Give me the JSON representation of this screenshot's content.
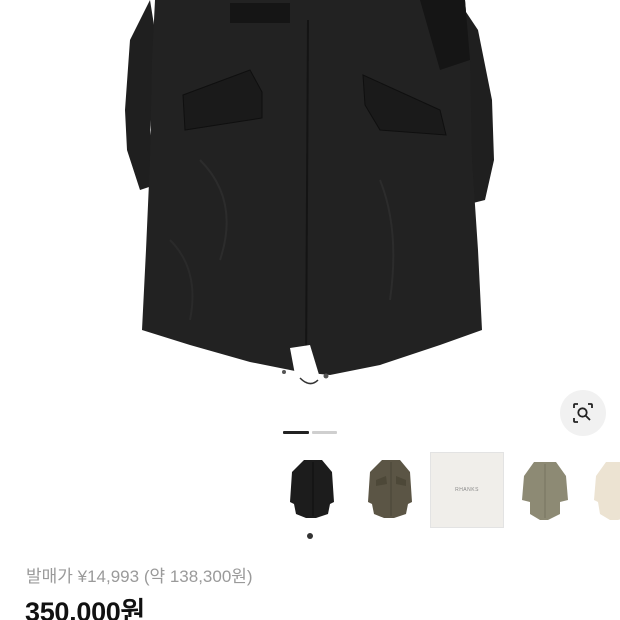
{
  "product": {
    "original_price_label": "발매가 ¥14,993 (약 138,300원)",
    "sale_price": "350,000원"
  },
  "gallery": {
    "current_slide": 1,
    "total_slides": 2
  },
  "thumbnails": {
    "items": [
      {
        "name": "black-coat",
        "selected": true
      },
      {
        "name": "olive-coat",
        "selected": false
      },
      {
        "name": "brand-box",
        "label": "RHANKS"
      },
      {
        "name": "khaki-coat",
        "selected": false
      },
      {
        "name": "cream-coat",
        "selected": false
      }
    ]
  },
  "icons": {
    "lens": "image-search-icon"
  }
}
